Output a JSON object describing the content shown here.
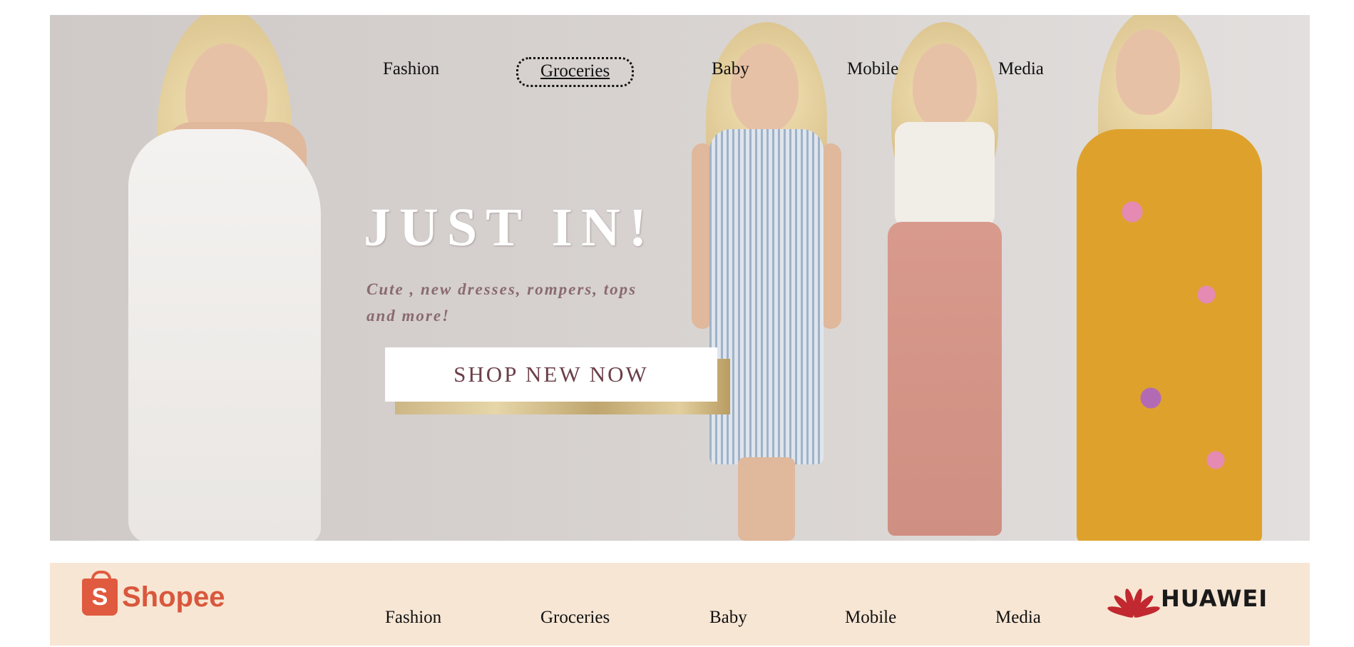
{
  "hero": {
    "nav": [
      "Fashion",
      "Groceries",
      "Baby",
      "Mobile",
      "Media"
    ],
    "active_nav": "Groceries",
    "headline": "JUST IN!",
    "subline": "Cute , new dresses, rompers, tops and more!",
    "cta_label": "SHOP NEW NOW"
  },
  "footer_bar": {
    "left_logo": "Shopee",
    "left_logo_mark": "S",
    "nav": [
      "Fashion",
      "Groceries",
      "Baby",
      "Mobile",
      "Media"
    ],
    "right_logo": "HUAWEI"
  },
  "colors": {
    "cta_text": "#6b3f4a",
    "subline": "#8a6a72",
    "bar_background": "#f7e6d4",
    "shopee": "#e05a3f",
    "huawei": "#c1282f"
  },
  "icons": [
    "shopee-bag-icon",
    "huawei-petals-icon"
  ]
}
